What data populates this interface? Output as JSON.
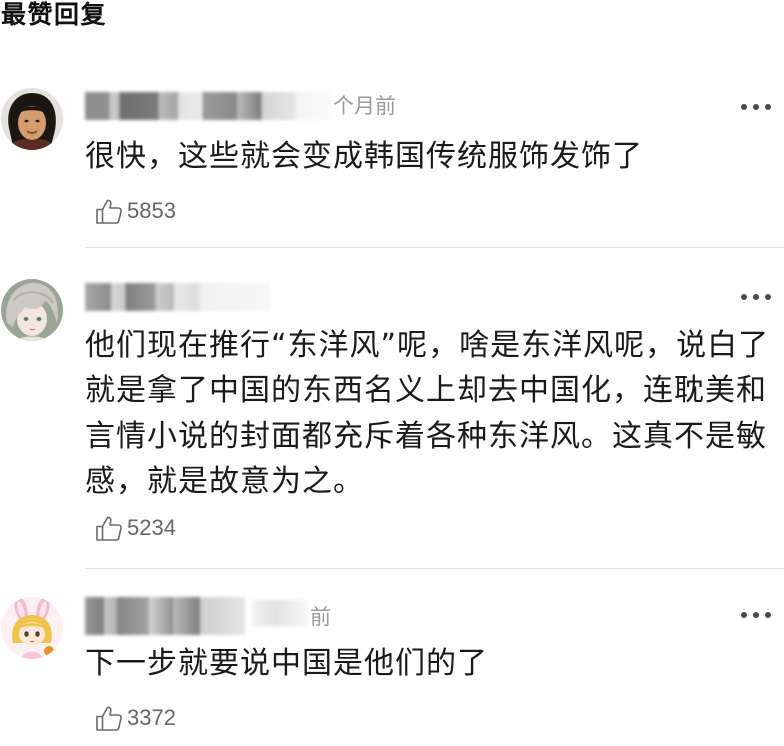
{
  "section_title": "最赞回复",
  "comments": [
    {
      "timestamp": "个月前",
      "text": "很快，这些就会变成韩国传统服饰发饰了",
      "likes": "5853"
    },
    {
      "text": "他们现在推行“东洋风”呢，啥是东洋风呢，说白了就是拿了中国的东西名义上却去中国化，连耽美和言情小说的封面都充斥着各种东洋风。这真不是敏感，就是故意为之。",
      "likes": "5234"
    },
    {
      "timestamp": "前",
      "text": "下一步就要说中国是他们的了",
      "likes": "3372"
    }
  ],
  "icons": {
    "like": "thumbs-up-icon",
    "more": "more-dots-icon"
  },
  "colors": {
    "text": "#1a1a1a",
    "timestamp": "#9b9b9b",
    "like": "#666666",
    "divider": "#e6e6e6",
    "more_dots": "#4a4a4a"
  }
}
